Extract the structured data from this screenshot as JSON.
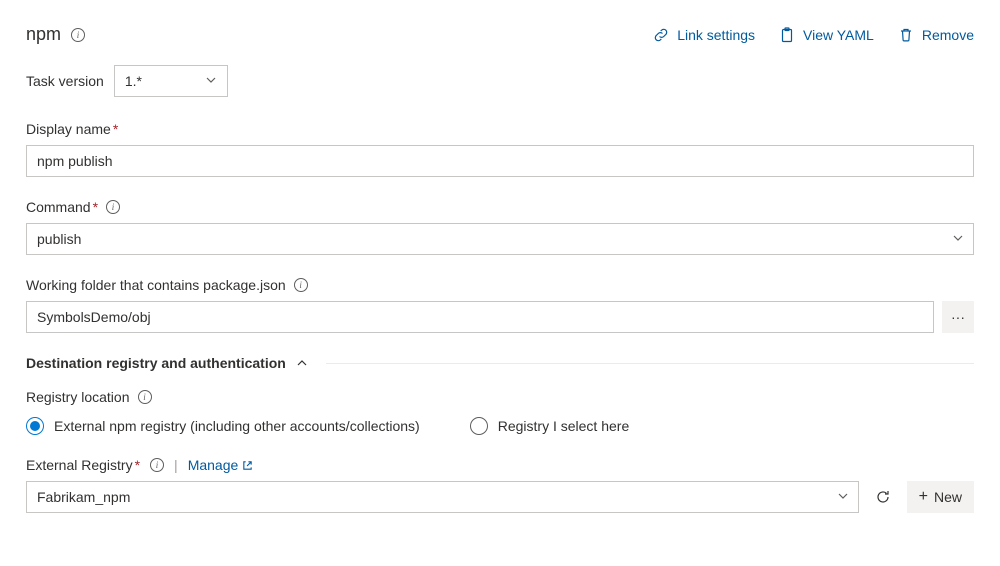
{
  "header": {
    "title": "npm",
    "links": {
      "link_settings": "Link settings",
      "view_yaml": "View YAML",
      "remove": "Remove"
    }
  },
  "task_version": {
    "label": "Task version",
    "value": "1.*"
  },
  "display_name": {
    "label": "Display name",
    "value": "npm publish"
  },
  "command": {
    "label": "Command",
    "value": "publish"
  },
  "working_folder": {
    "label": "Working folder that contains package.json",
    "value": "SymbolsDemo/obj"
  },
  "section": {
    "title": "Destination registry and authentication"
  },
  "registry_location": {
    "label": "Registry location",
    "options": {
      "external": "External npm registry (including other accounts/collections)",
      "select_here": "Registry I select here"
    },
    "selected": "external"
  },
  "external_registry": {
    "label": "External Registry",
    "manage": "Manage",
    "value": "Fabrikam_npm",
    "new_label": "New"
  }
}
